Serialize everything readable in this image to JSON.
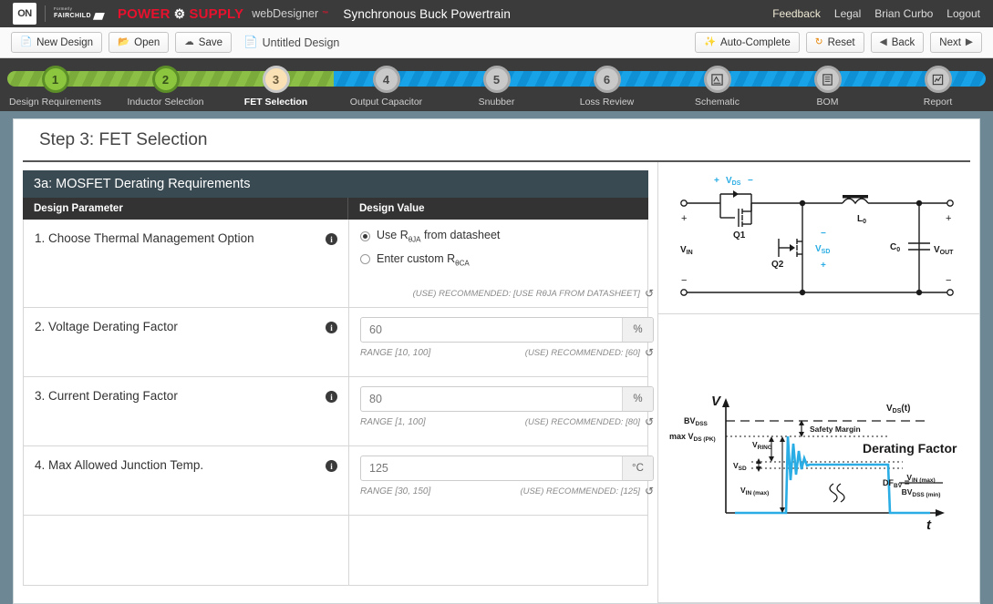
{
  "topbar": {
    "logo_on": "ON",
    "logo_formerly": "Formerly",
    "logo_fairchild": "FAIRCHILD",
    "brand_power": "POWER",
    "brand_supply": "SUPPLY",
    "brand_gear_icon": "gear-icon",
    "webdesigner": "webDesigner",
    "tm": "™",
    "doc_title": "Synchronous Buck Powertrain",
    "links": [
      {
        "label": "Feedback",
        "name": "feedback-link"
      },
      {
        "label": "Legal",
        "name": "legal-link"
      },
      {
        "label": "Brian Curbo",
        "name": "user-account-link"
      },
      {
        "label": "Logout",
        "name": "logout-link"
      }
    ]
  },
  "toolbar": {
    "new_design": "New Design",
    "open": "Open",
    "save": "Save",
    "file_name": "Untitled Design",
    "auto_complete": "Auto-Complete",
    "reset": "Reset",
    "back": "Back",
    "next": "Next"
  },
  "steps": [
    {
      "num": "1",
      "label": "Design Requirements",
      "state": "done"
    },
    {
      "num": "2",
      "label": "Inductor Selection",
      "state": "done"
    },
    {
      "num": "3",
      "label": "FET Selection",
      "state": "current"
    },
    {
      "num": "4",
      "label": "Output Capacitor",
      "state": "todo"
    },
    {
      "num": "5",
      "label": "Snubber",
      "state": "todo"
    },
    {
      "num": "6",
      "label": "Loss Review",
      "state": "todo"
    },
    {
      "num": "",
      "label": "Schematic",
      "state": "todo",
      "icon": "schematic-icon"
    },
    {
      "num": "",
      "label": "BOM",
      "state": "todo",
      "icon": "bom-icon"
    },
    {
      "num": "",
      "label": "Report",
      "state": "todo",
      "icon": "report-icon"
    }
  ],
  "page": {
    "title": "Step 3: FET Selection",
    "section_title": "3a: MOSFET Derating Requirements",
    "col_param": "Design Parameter",
    "col_value": "Design Value"
  },
  "rows": [
    {
      "label": "1. Choose Thermal Management Option",
      "type": "radio",
      "options": [
        {
          "label_pre": "Use R",
          "sub": "θJA",
          "label_post": " from datasheet",
          "selected": true
        },
        {
          "label_pre": "Enter custom R",
          "sub": "θCA",
          "label_post": "",
          "selected": false
        }
      ],
      "recommended": "(USE) RECOMMENDED: [USE RθJA FROM DATASHEET]"
    },
    {
      "label": "2. Voltage Derating Factor",
      "type": "input",
      "value": "60",
      "unit": "%",
      "range": "RANGE [10, 100]",
      "recommended": "(USE) RECOMMENDED: [60]"
    },
    {
      "label": "3. Current Derating Factor",
      "type": "input",
      "value": "80",
      "unit": "%",
      "range": "RANGE [1, 100]",
      "recommended": "(USE) RECOMMENDED: [80]"
    },
    {
      "label": "4. Max Allowed Junction Temp.",
      "type": "input",
      "value": "125",
      "unit": "°C",
      "range": "RANGE [30, 150]",
      "recommended": "(USE) RECOMMENDED: [125]"
    }
  ],
  "schematic": {
    "vds": "V",
    "vds_sub": "DS",
    "q1": "Q1",
    "q2": "Q2",
    "vsd": "V",
    "vsd_sub": "SD",
    "l0": "L",
    "l0_sub": "0",
    "c0": "C",
    "c0_sub": "0",
    "vin": "V",
    "vin_sub": "IN",
    "vout": "V",
    "vout_sub": "OUT",
    "plus": "+",
    "minus": "−",
    "accent_color": "#29ade4"
  },
  "waveform": {
    "axis_v": "V",
    "axis_t": "t",
    "vds_t": "V",
    "vds_t_sub": "DS",
    "vds_t_suffix": "(t)",
    "bvdss": "BV",
    "bvdss_sub": "DSS",
    "max_vds": "max V",
    "max_vds_sub": "DS (PK)",
    "safety_margin": "Safety Margin",
    "vring": "V",
    "vring_sub": "RING",
    "vsd": "V",
    "vsd_sub": "SD",
    "vin_max": "V",
    "vin_max_sub": "IN (max)",
    "derating_factor": "Derating Factor",
    "df_bv": "DF",
    "df_bv_sub": "BV",
    "eq": "=",
    "eq_num": "V",
    "eq_num_sub": "IN (max)",
    "eq_den": "BV",
    "eq_den_sub": "DSS (min)",
    "trace_color": "#29ade4"
  }
}
